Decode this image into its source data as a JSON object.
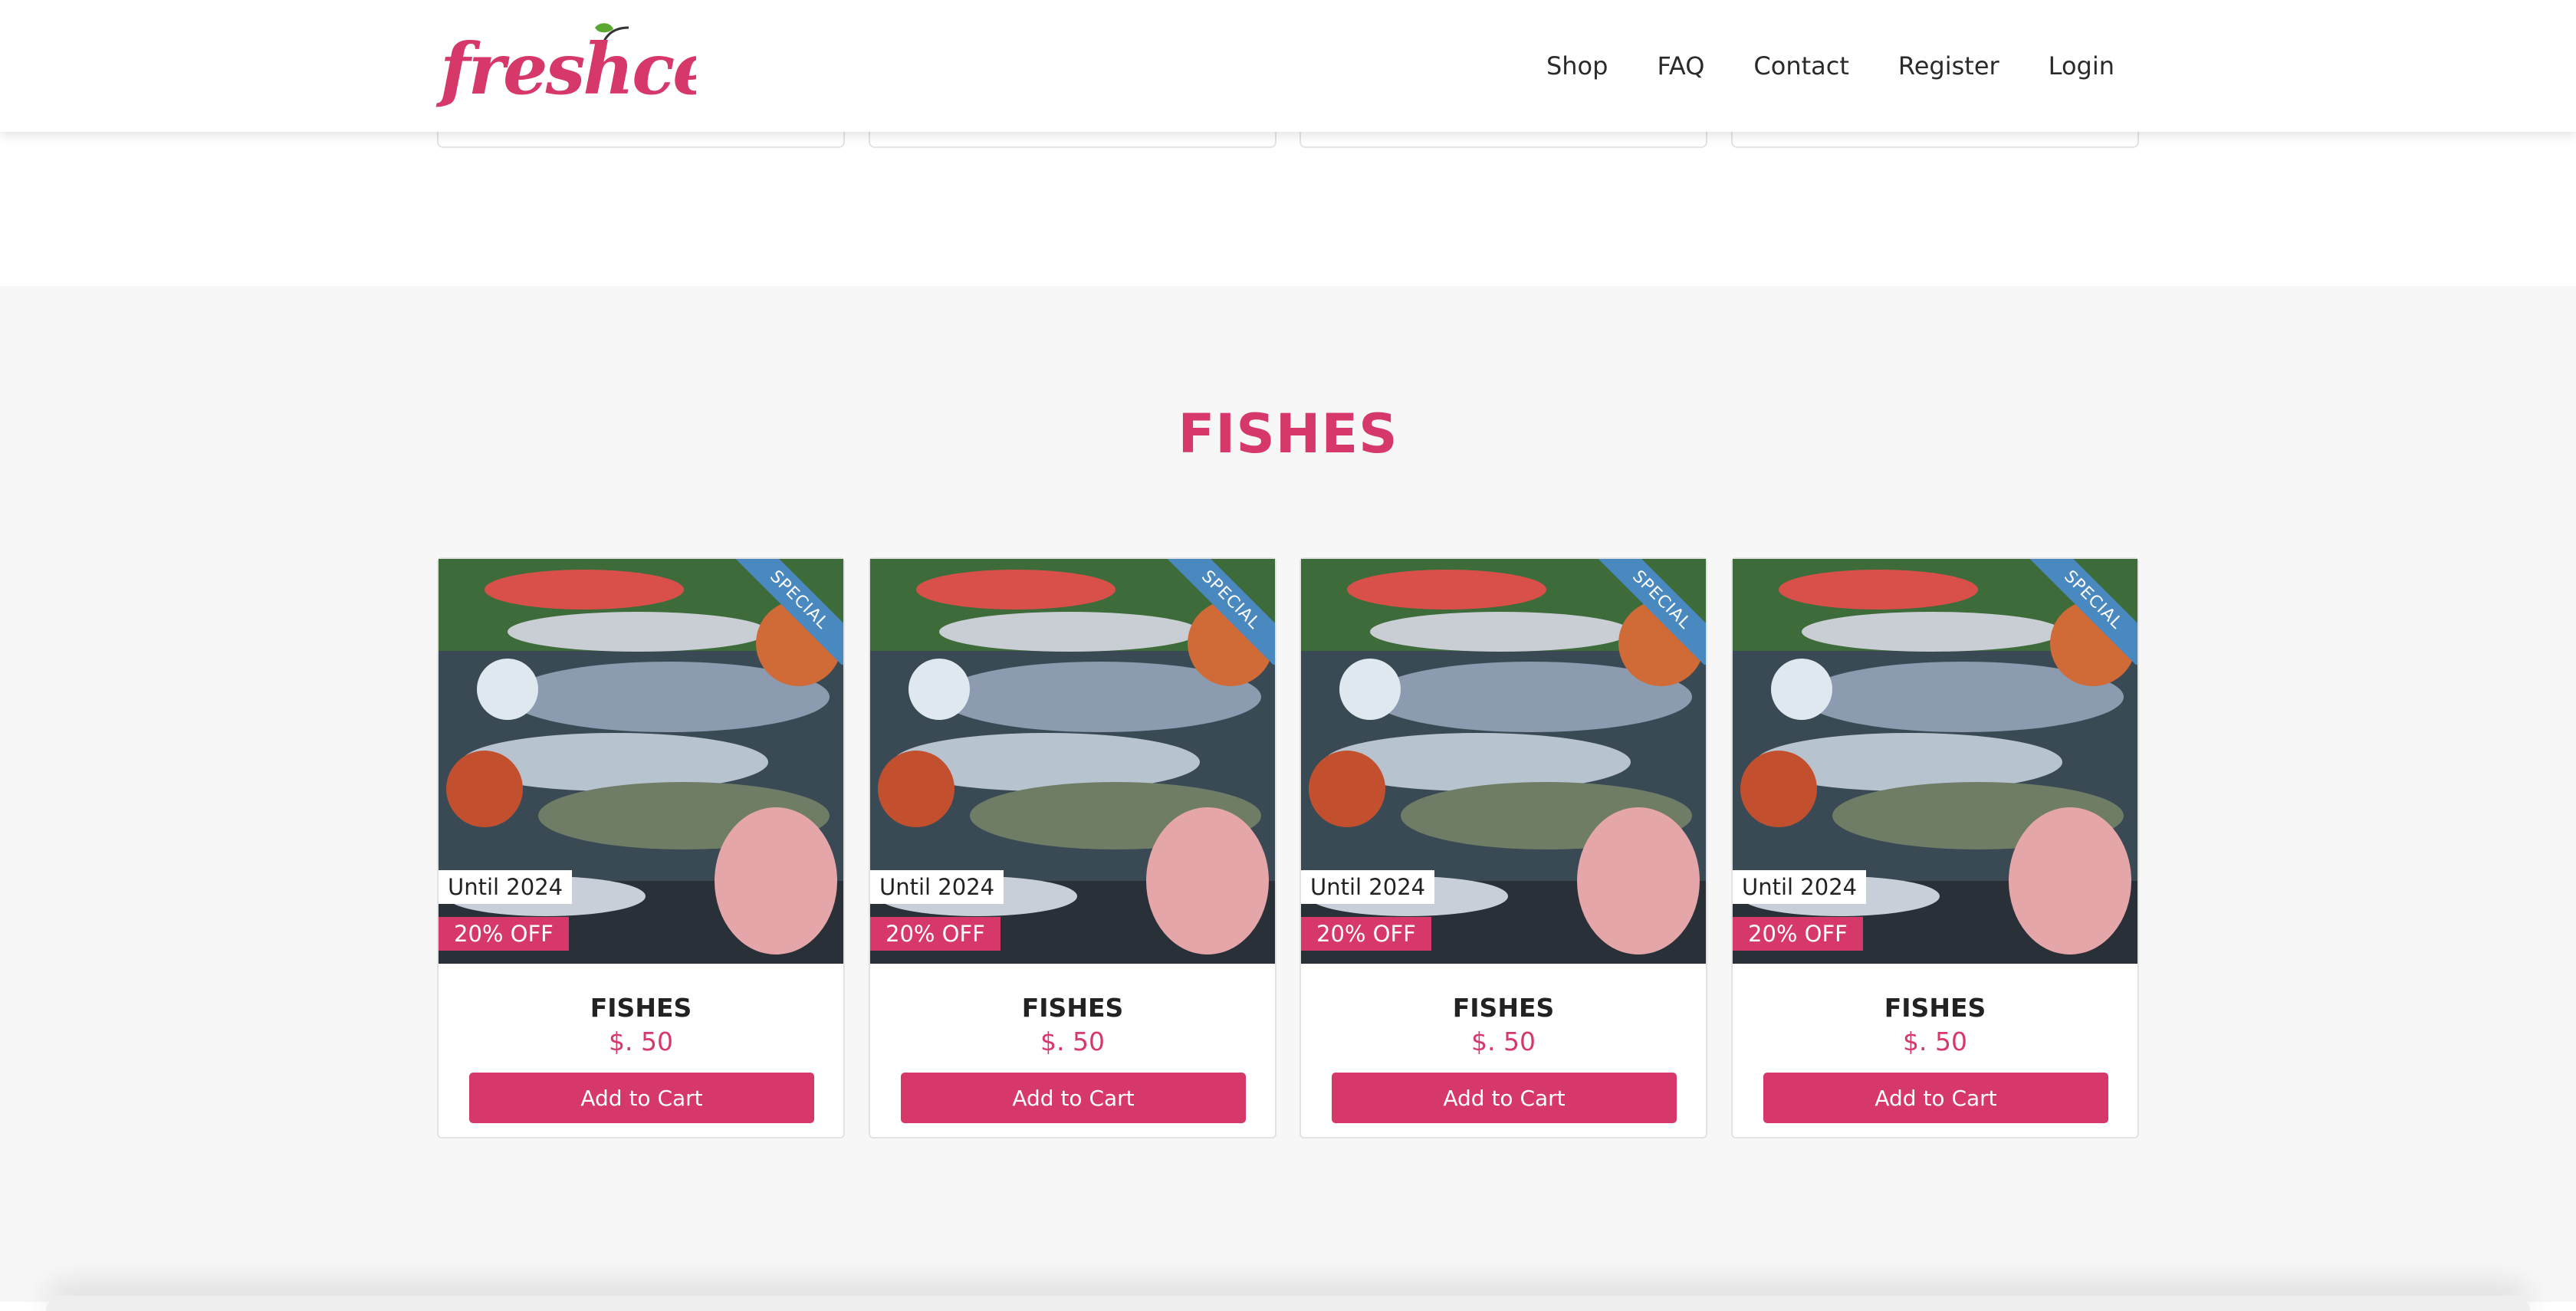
{
  "brand": {
    "name": "freshcery",
    "accent": "#d7386a",
    "leaf": "#5aa830"
  },
  "nav": {
    "items": [
      {
        "label": "Shop"
      },
      {
        "label": "FAQ"
      },
      {
        "label": "Contact"
      },
      {
        "label": "Register"
      },
      {
        "label": "Login"
      }
    ]
  },
  "section": {
    "title": "FISHES"
  },
  "products": [
    {
      "ribbon": "SPECIAL",
      "until": "Until 2024",
      "discount": "20% OFF",
      "name": "FISHES",
      "price": "$. 50",
      "button": "Add to Cart"
    },
    {
      "ribbon": "SPECIAL",
      "until": "Until 2024",
      "discount": "20% OFF",
      "name": "FISHES",
      "price": "$. 50",
      "button": "Add to Cart"
    },
    {
      "ribbon": "SPECIAL",
      "until": "Until 2024",
      "discount": "20% OFF",
      "name": "FISHES",
      "price": "$. 50",
      "button": "Add to Cart"
    },
    {
      "ribbon": "SPECIAL",
      "until": "Until 2024",
      "discount": "20% OFF",
      "name": "FISHES",
      "price": "$. 50",
      "button": "Add to Cart"
    }
  ],
  "colors": {
    "ribbon": "#4a88c0",
    "section_bg": "#f7f7f7"
  }
}
